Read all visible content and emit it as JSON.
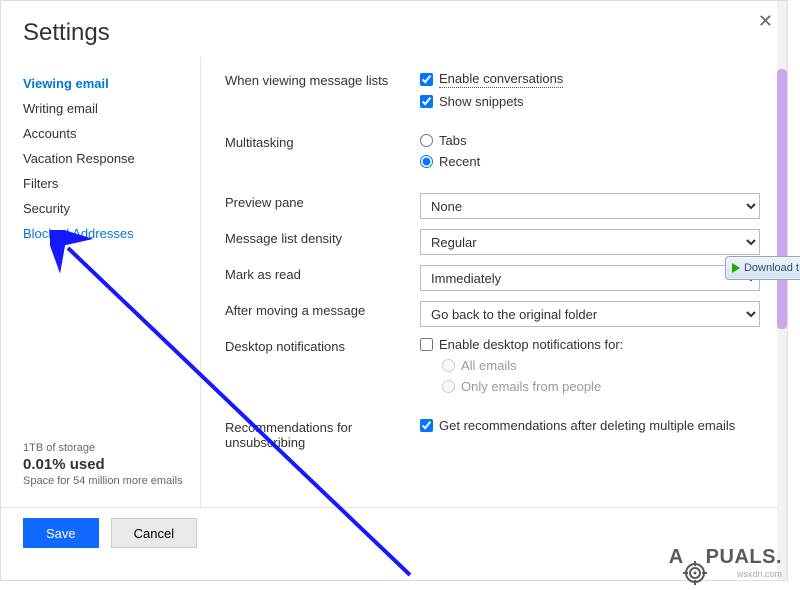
{
  "header": {
    "title": "Settings"
  },
  "sidebar": {
    "items": [
      {
        "label": "Viewing email"
      },
      {
        "label": "Writing email"
      },
      {
        "label": "Accounts"
      },
      {
        "label": "Vacation Response"
      },
      {
        "label": "Filters"
      },
      {
        "label": "Security"
      },
      {
        "label": "Blocked Addresses"
      }
    ],
    "storage": {
      "line1": "1TB of storage",
      "pct": "0.01% used",
      "line2": "Space for 54 million more emails"
    }
  },
  "main": {
    "viewing_lists": {
      "label": "When viewing message lists",
      "enable_conversations": "Enable conversations",
      "show_snippets": "Show snippets"
    },
    "multitasking": {
      "label": "Multitasking",
      "tabs": "Tabs",
      "recent": "Recent"
    },
    "preview_pane": {
      "label": "Preview pane",
      "value": "None"
    },
    "density": {
      "label": "Message list density",
      "value": "Regular"
    },
    "mark_read": {
      "label": "Mark as read",
      "value": "Immediately"
    },
    "after_move": {
      "label": "After moving a message",
      "value": "Go back to the original folder"
    },
    "desktop_notif": {
      "label": "Desktop notifications",
      "enable": "Enable desktop notifications for:",
      "all": "All emails",
      "people": "Only emails from people"
    },
    "recommendations": {
      "label": "Recommendations for unsubscribing",
      "get": "Get recommendations after deleting multiple emails"
    }
  },
  "footer": {
    "save": "Save",
    "cancel": "Cancel"
  },
  "overlay": {
    "download": "Download t",
    "watermark_prefix": "A",
    "watermark_suffix": "PUALS.",
    "source": "wsxdn.com"
  }
}
